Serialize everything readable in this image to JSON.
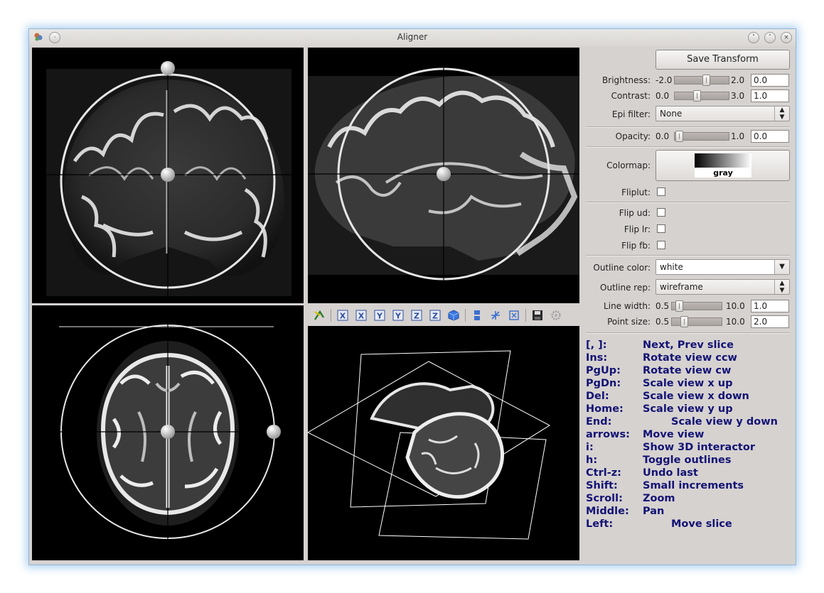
{
  "window": {
    "title": "Aligner"
  },
  "toolbar": {
    "icons": [
      "pointer-icon",
      "view-x-icon",
      "view-x-reverse-icon",
      "view-y-icon",
      "view-y-reverse-icon",
      "view-z-icon",
      "view-z-reverse-icon",
      "cube-icon",
      "layout-icon",
      "axes-icon",
      "fit-view-icon",
      "save-icon",
      "settings-icon"
    ],
    "x_label": "X",
    "y_label": "Y",
    "z_label": "Z"
  },
  "panel": {
    "save_label": "Save Transform",
    "brightness": {
      "label": "Brightness:",
      "min": "-2.0",
      "max": "2.0",
      "value": "0.0",
      "fraction": 0.5
    },
    "contrast": {
      "label": "Contrast:",
      "min": "0.0",
      "max": "3.0",
      "value": "1.0",
      "fraction": 0.333
    },
    "epi_filter": {
      "label": "Epi filter:",
      "value": "None"
    },
    "opacity": {
      "label": "Opacity:",
      "min": "0.0",
      "max": "1.0",
      "value": "0.0",
      "fraction": 0.0
    },
    "colormap": {
      "label": "Colormap:",
      "name": "gray"
    },
    "fliplut": {
      "label": "Fliplut:"
    },
    "flip_ud": {
      "label": "Flip ud:"
    },
    "flip_lr": {
      "label": "Flip lr:"
    },
    "flip_fb": {
      "label": "Flip fb:"
    },
    "outline_color": {
      "label": "Outline color:",
      "value": "white"
    },
    "outline_rep": {
      "label": "Outline rep:",
      "value": "wireframe"
    },
    "line_width": {
      "label": "Line width:",
      "min": "0.5",
      "max": "10.0",
      "value": "1.0",
      "fraction": 0.053
    },
    "point_size": {
      "label": "Point size:",
      "min": "0.5",
      "max": "10.0",
      "value": "2.0",
      "fraction": 0.158
    }
  },
  "shortcuts": [
    {
      "key": "[, ]:",
      "desc": "Next, Prev slice"
    },
    {
      "key": "Ins:",
      "desc": "Rotate view ccw"
    },
    {
      "key": "PgUp:",
      "desc": "Rotate view cw"
    },
    {
      "key": "PgDn:",
      "desc": "Scale view x up"
    },
    {
      "key": "Del:",
      "desc": "Scale view x down"
    },
    {
      "key": "Home:",
      "desc": "Scale view y up"
    },
    {
      "key": "End:",
      "desc": "Scale view y down"
    },
    {
      "key": "arrows:",
      "desc": "Move view"
    },
    {
      "key": "i:",
      "desc": "Show 3D interactor"
    },
    {
      "key": "h:",
      "desc": "Toggle outlines"
    },
    {
      "key": "Ctrl-z:",
      "desc": "Undo last"
    },
    {
      "key": "Shift:",
      "desc": "Small increments"
    },
    {
      "key": "Scroll:",
      "desc": "Zoom"
    },
    {
      "key": "Middle:",
      "desc": "Pan"
    },
    {
      "key": "Left:",
      "desc": "Move slice"
    }
  ]
}
